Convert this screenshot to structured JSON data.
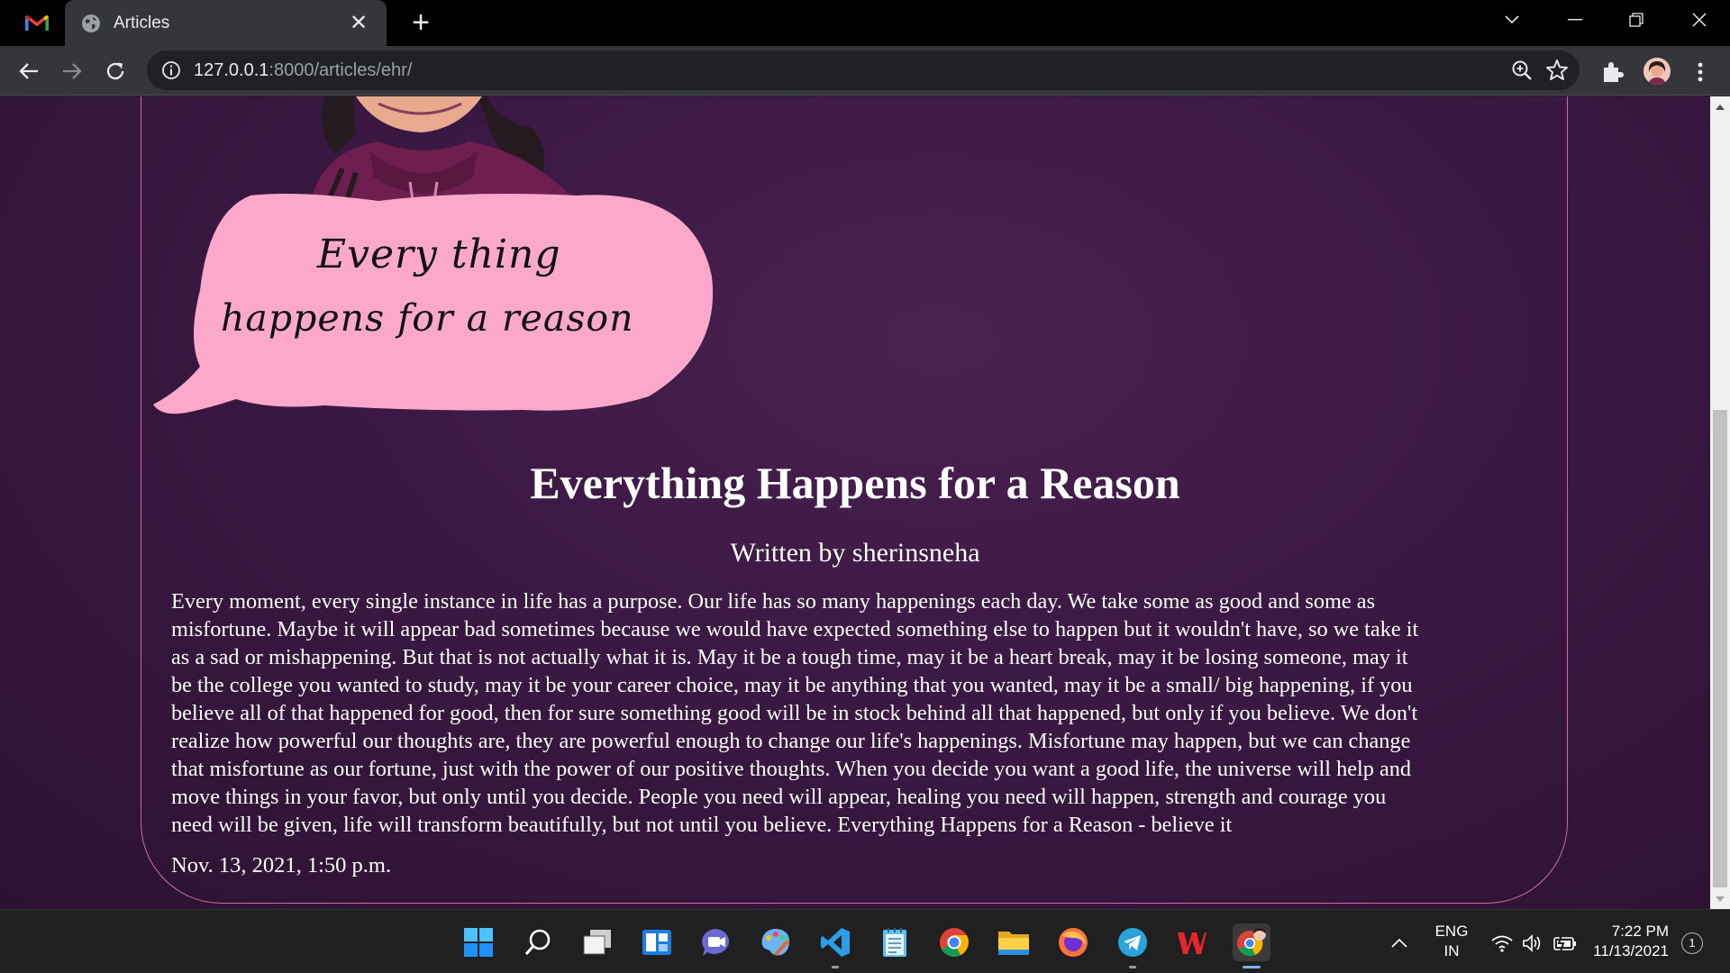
{
  "browser": {
    "tab_title": "Articles",
    "url_host": "127.0.0.1",
    "url_rest": ":8000/articles/ehr/"
  },
  "illustration": {
    "bubble_line1": "Every thing",
    "bubble_line2": "happens for a reason"
  },
  "article": {
    "title": "Everything Happens for a Reason",
    "author": "Written by sherinsneha",
    "body_lines": [
      "Every moment, every single instance in life has a purpose. Our life has so many happenings each day. We take some as good and some as",
      "misfortune. Maybe it will appear bad sometimes because we would have expected something else to happen but it wouldn't have, so we take it",
      "as a sad or mishappening. But that is not actually what it is. May it be a tough time, may it be a heart break, may it be losing someone, may it",
      "be the college you wanted to study, may it be your career choice, may it be anything that you wanted, may it be a small/ big happening, if you",
      "believe all of that happened for good, then for sure something good will be in stock behind all that happened, but only if you believe. We don't",
      "realize how powerful our thoughts are, they are powerful enough to change our life's happenings. Misfortune may happen, but we can change",
      "that misfortune as our fortune, just with the power of our positive thoughts. When you decide you want a good life, the universe will help and",
      "move things in your favor, but only until you decide. People you need will appear, healing you need will happen, strength and courage you",
      "need will be given, life will transform beautifully, but not until you believe. Everything Happens for a Reason - believe it"
    ],
    "date": "Nov. 13, 2021, 1:50 p.m."
  },
  "taskbar": {
    "lang_top": "ENG",
    "lang_bottom": "IN",
    "time": "7:22 PM",
    "date": "11/13/2021",
    "notification_count": "1",
    "apps": [
      "start-icon",
      "search-icon",
      "task-view-icon",
      "widgets-icon",
      "teams-chat-icon",
      "paint-icon",
      "vscode-icon",
      "notepad-icon",
      "chrome-icon",
      "file-explorer-icon",
      "firefox-icon",
      "telegram-icon",
      "wps-office-icon",
      "chrome-profile-icon"
    ]
  },
  "colors": {
    "page_background": "#3b1843",
    "card_border": "#c76ab5",
    "bubble_pink": "#fba8cb"
  }
}
